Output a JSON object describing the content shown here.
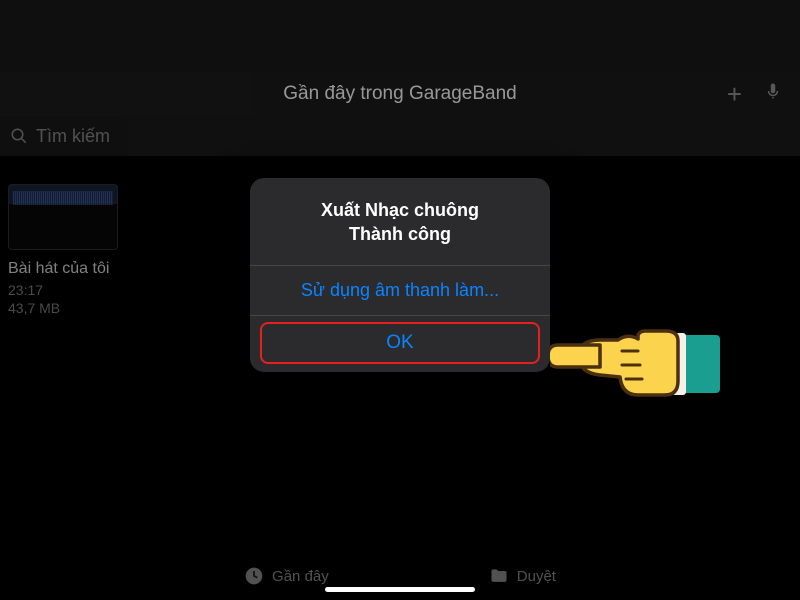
{
  "toolbar": {},
  "header": {
    "title": "Gần đây trong GarageBand"
  },
  "search": {
    "placeholder": "Tìm kiếm"
  },
  "song": {
    "title": "Bài hát của tôi",
    "time": "23:17",
    "size": "43,7 MB"
  },
  "dialog": {
    "title_line1": "Xuất Nhạc chuông",
    "title_line2": "Thành công",
    "use_sound_label": "Sử dụng âm thanh làm...",
    "ok_label": "OK"
  },
  "tabs": {
    "recent": "Gần đây",
    "browse": "Duyệt"
  },
  "colors": {
    "accent": "#0a84ff",
    "highlight": "#e52020",
    "background": "#000000"
  }
}
